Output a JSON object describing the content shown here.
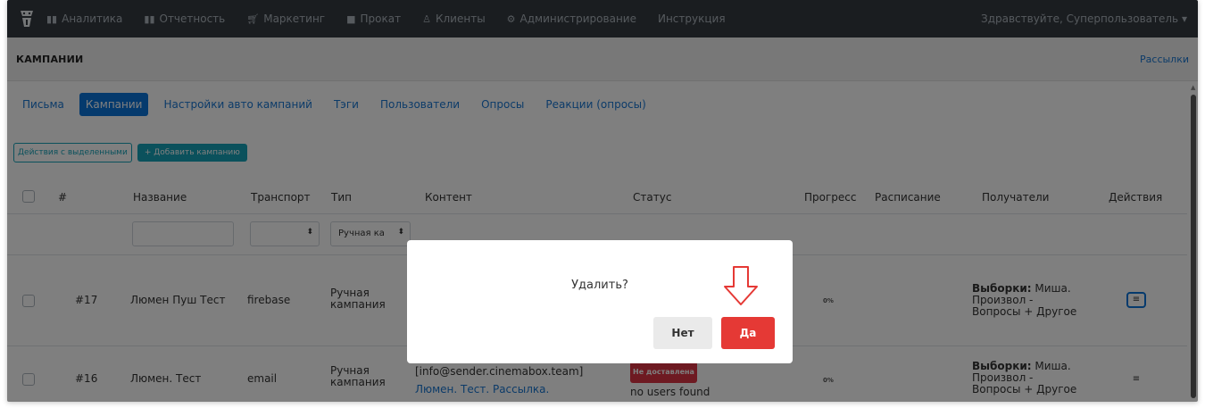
{
  "navbar": {
    "logo_icon": "cinema-logo-icon",
    "items": [
      {
        "label": "Аналитика",
        "icon": "bar-chart-icon"
      },
      {
        "label": "Отчетность",
        "icon": "bar-chart-icon"
      },
      {
        "label": "Маркетинг",
        "icon": "cart-icon"
      },
      {
        "label": "Прокат",
        "icon": "film-icon"
      },
      {
        "label": "Клиенты",
        "icon": "user-icon"
      },
      {
        "label": "Администрирование",
        "icon": "gears-icon"
      },
      {
        "label": "Инструкция",
        "icon": ""
      }
    ],
    "user_greeting": "Здравствуйте, Суперпользователь"
  },
  "page": {
    "title": "КАМПАНИИ",
    "link": "Рассылки"
  },
  "tabs": [
    {
      "label": "Письма",
      "active": false
    },
    {
      "label": "Кампании",
      "active": true
    },
    {
      "label": "Настройки авто кампаний",
      "active": false
    },
    {
      "label": "Тэги",
      "active": false
    },
    {
      "label": "Пользователи",
      "active": false
    },
    {
      "label": "Опросы",
      "active": false
    },
    {
      "label": "Реакции (опросы)",
      "active": false
    }
  ],
  "actions": {
    "bulk_label": "Действия с выделенными",
    "add_label": "+ Добавить кампанию"
  },
  "table": {
    "headers": {
      "num": "#",
      "name": "Название",
      "transport": "Транспорт",
      "type": "Тип",
      "content": "Контент",
      "status": "Статус",
      "progress": "Прогресс",
      "schedule": "Расписание",
      "recipients": "Получатели",
      "actions": "Действия"
    },
    "filters": {
      "type_value": "Ручная ка"
    },
    "rows": [
      {
        "num": "#17",
        "name": "Люмен Пуш Тест",
        "transport": "firebase",
        "type_line1": "Ручная",
        "type_line2": "кампания",
        "content_line1": "",
        "content_line2": "",
        "status_badge": "",
        "status_text": "",
        "progress": "0%",
        "recipients_label": "Выборки:",
        "recipients_line1": "Миша.",
        "recipients_line2": "Произвол -",
        "recipients_line3": "Вопросы + Другое"
      },
      {
        "num": "#16",
        "name": "Люмен. Тест",
        "transport": "email",
        "type_line1": "Ручная",
        "type_line2": "кампания",
        "content_line1": "[info@sender.cinemabox.team]",
        "content_line2": "Люмен. Тест. Рассылка.",
        "status_badge": "Не доставлена",
        "status_text": "no users found",
        "progress": "0%",
        "recipients_label": "Выборки:",
        "recipients_line1": "Миша.",
        "recipients_line2": "Произвол -",
        "recipients_line3": "Вопросы + Другое"
      }
    ]
  },
  "modal": {
    "question": "Удалить?",
    "no_label": "Нет",
    "yes_label": "Да",
    "annotation_icon": "down-arrow-outline-icon"
  },
  "colors": {
    "navbar_bg": "#343a40",
    "primary": "#0a74da",
    "info": "#17a2b8",
    "danger": "#e53935",
    "overlay": "rgba(0,0,0,0.5)"
  }
}
